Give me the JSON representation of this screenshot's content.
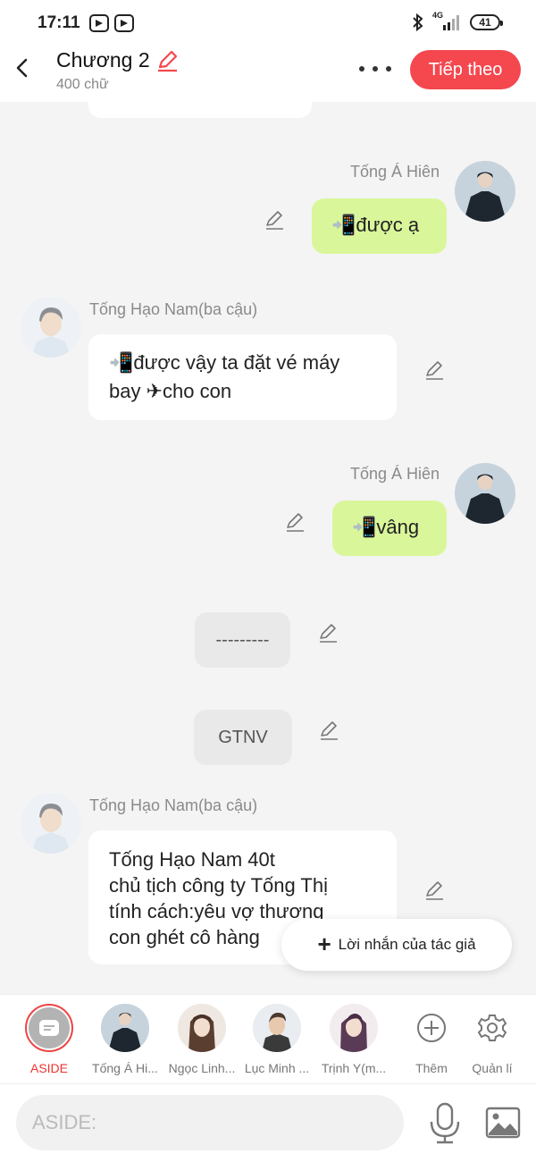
{
  "status_bar": {
    "time": "17:11",
    "network": "4G",
    "battery": "41"
  },
  "header": {
    "title": "Chương 2",
    "subtitle": "400 chữ",
    "next_label": "Tiếp theo"
  },
  "colors": {
    "accent": "#f4474e",
    "green_bubble": "#d9f79a",
    "white_bubble": "#ffffff"
  },
  "messages": [
    {
      "side": "right",
      "sender": "Tống Á Hiên",
      "text": "📲được ạ"
    },
    {
      "side": "left",
      "sender": "Tống Hạo Nam(ba cậu)",
      "line1": "📲được vậy ta đặt vé máy",
      "line2": "bay ✈cho con"
    },
    {
      "side": "right",
      "sender": "Tống Á Hiên",
      "text": "📲vâng"
    },
    {
      "side": "center",
      "text": "---------"
    },
    {
      "side": "center",
      "text": "GTNV"
    },
    {
      "side": "left",
      "sender": "Tống Hạo Nam(ba cậu)",
      "line1": "Tống Hạo Nam 40t",
      "line2": "chủ tịch công ty Tống Thị",
      "line3": "tính cách:yêu vợ thương",
      "line4": "con ghét cô hàng"
    }
  ],
  "author_note": {
    "label": "Lời nhắn của tác giả"
  },
  "characters": [
    {
      "label": "ASIDE",
      "selected": true
    },
    {
      "label": "Tống Á Hi..."
    },
    {
      "label": "Ngọc Linh..."
    },
    {
      "label": "Lục Minh ..."
    },
    {
      "label": "Trịnh Y(m..."
    }
  ],
  "tools": {
    "add_label": "Thêm",
    "manage_label": "Quản lí"
  },
  "input": {
    "placeholder": "ASIDE:"
  }
}
